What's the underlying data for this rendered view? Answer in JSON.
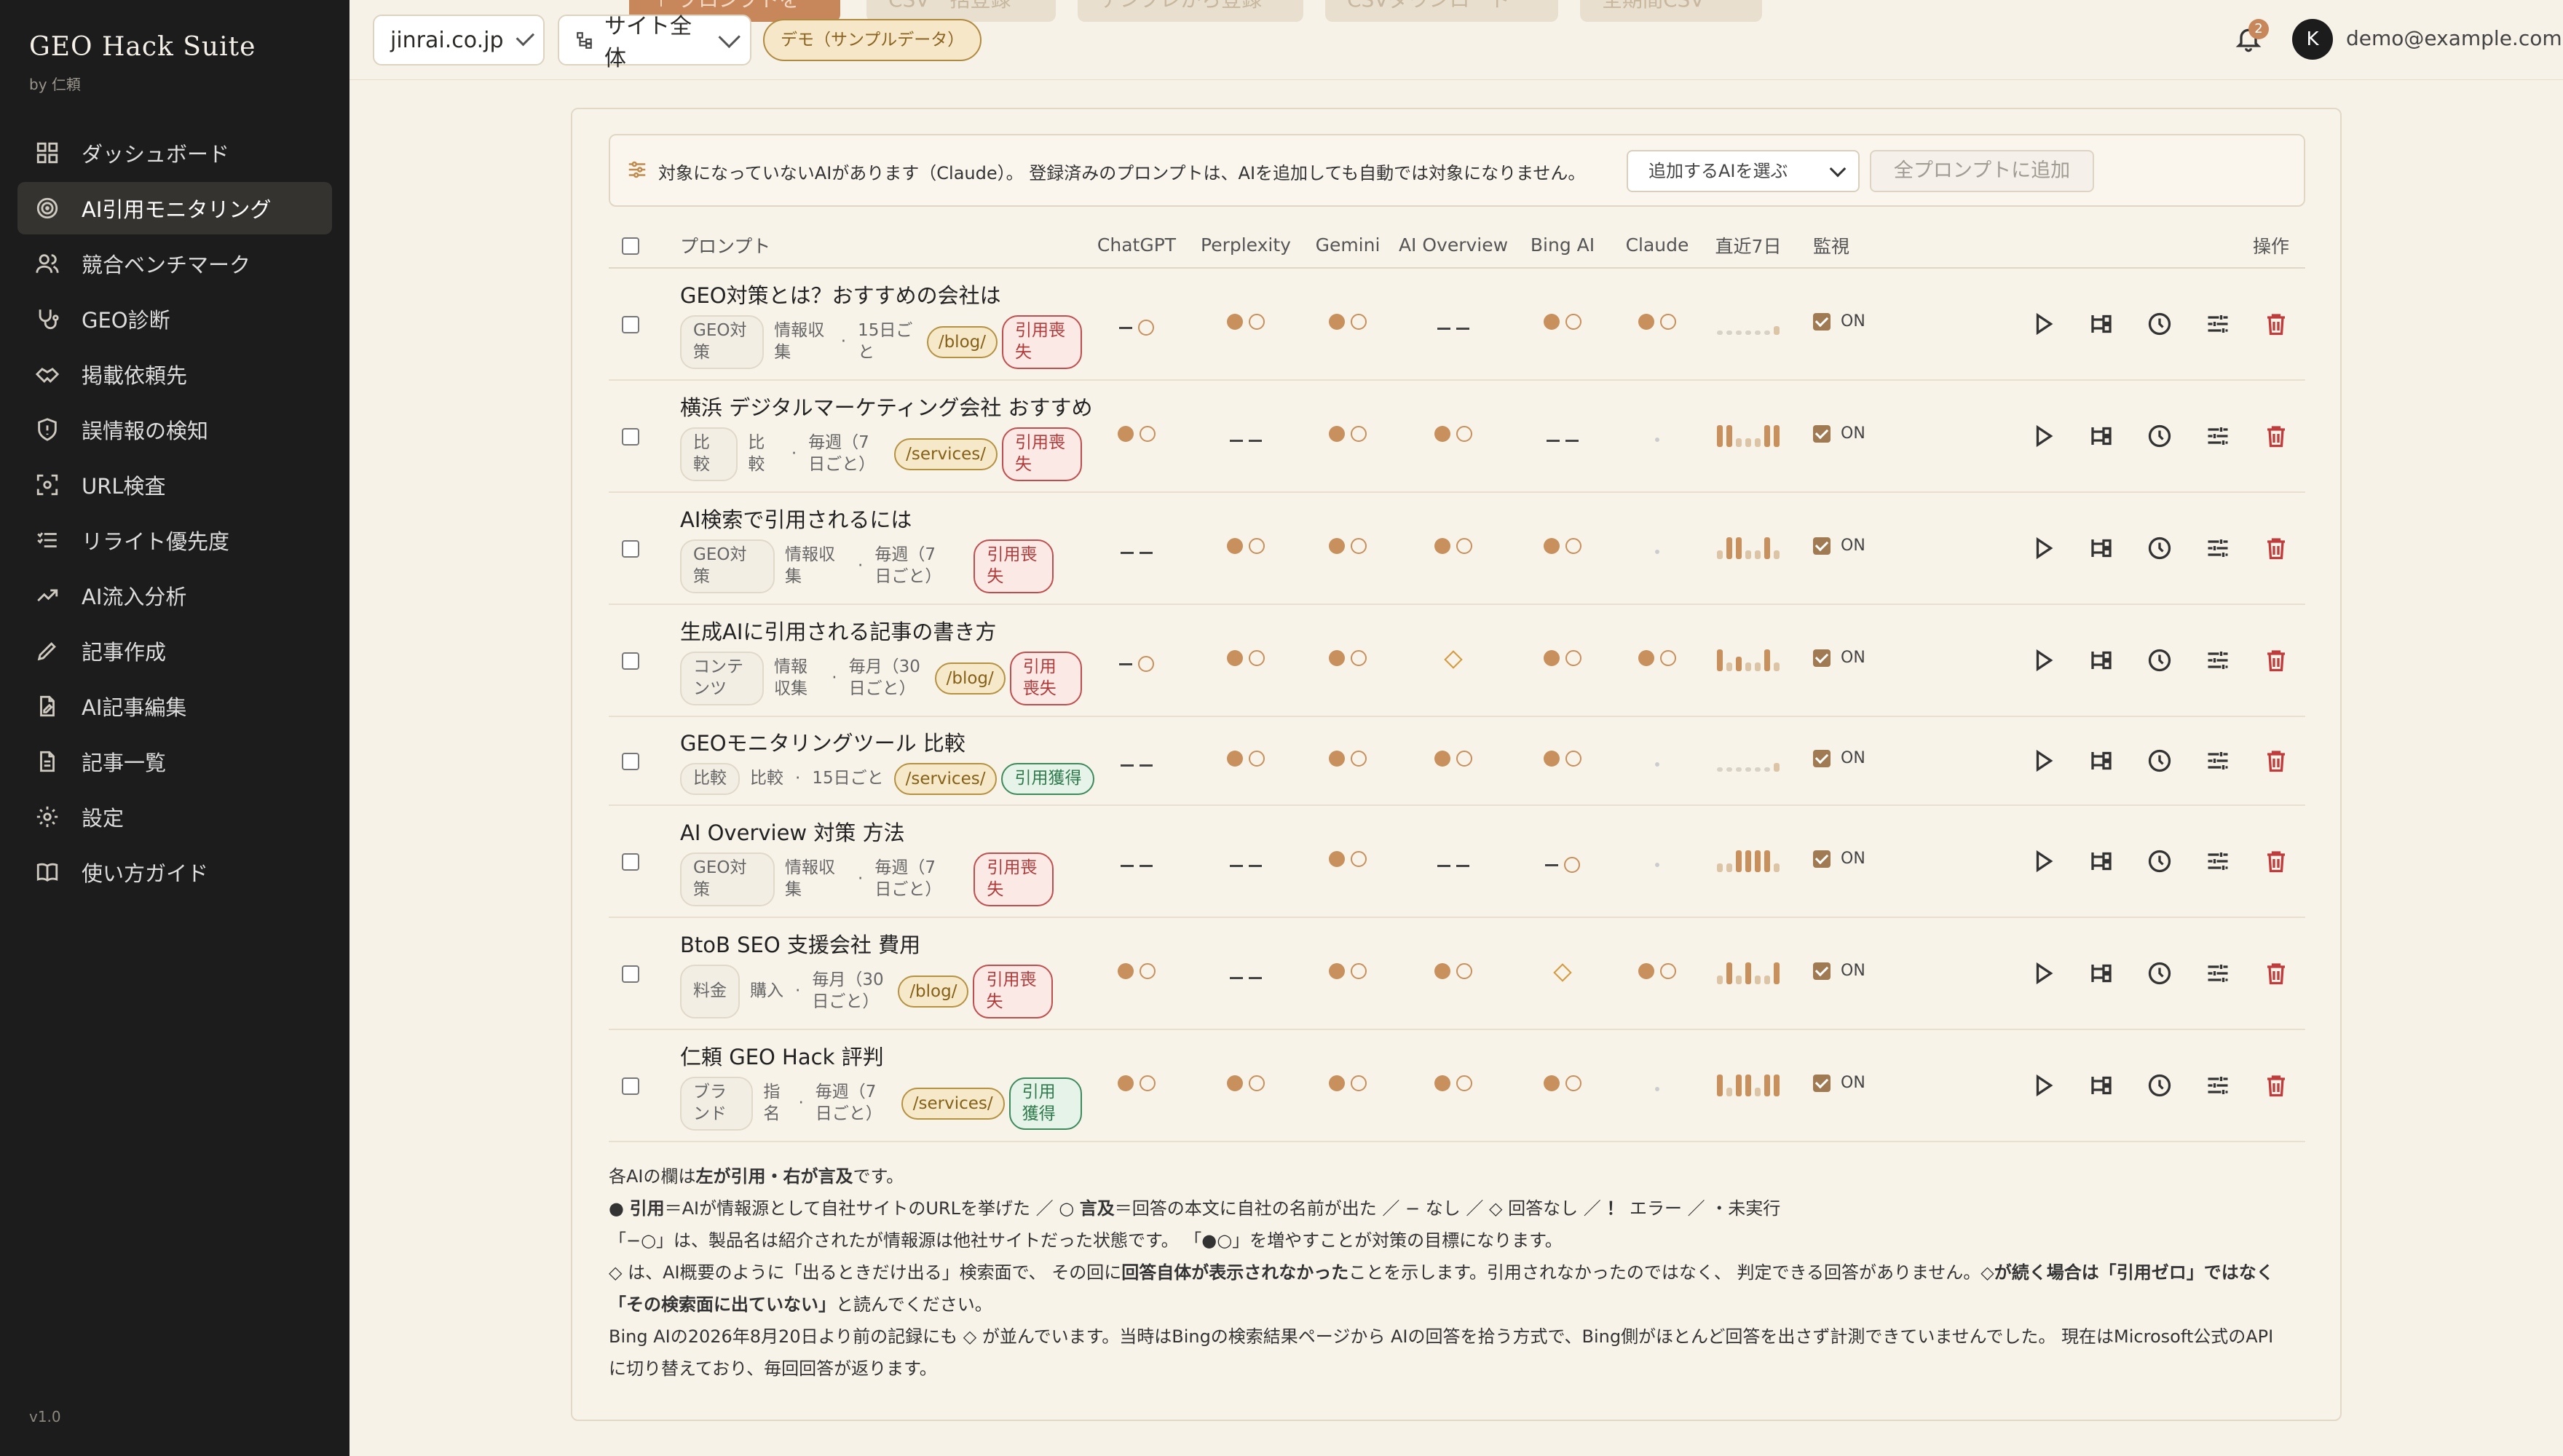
{
  "sidebar": {
    "brand": "GEO Hack Suite",
    "brand_sub": "by 仁頼",
    "items": [
      {
        "label": "ダッシュボード",
        "icon": "grid-icon"
      },
      {
        "label": "AI引用モニタリング",
        "icon": "target-icon",
        "active": true
      },
      {
        "label": "競合ベンチマーク",
        "icon": "users-icon"
      },
      {
        "label": "GEO診断",
        "icon": "stethoscope-icon"
      },
      {
        "label": "掲載依頼先",
        "icon": "handshake-icon"
      },
      {
        "label": "誤情報の検知",
        "icon": "shield-icon"
      },
      {
        "label": "URL検査",
        "icon": "scan-icon"
      },
      {
        "label": "リライト優先度",
        "icon": "list-icon"
      },
      {
        "label": "AI流入分析",
        "icon": "trend-icon"
      },
      {
        "label": "記事作成",
        "icon": "pen-icon"
      },
      {
        "label": "AI記事編集",
        "icon": "file-edit-icon"
      },
      {
        "label": "記事一覧",
        "icon": "file-list-icon"
      },
      {
        "label": "設定",
        "icon": "gear-icon"
      },
      {
        "label": "使い方ガイド",
        "icon": "book-icon"
      }
    ],
    "version": "v1.0"
  },
  "topbar": {
    "ghost_buttons": [
      "＋ プロンプトを追加",
      "CSV一括登録",
      "テンプレから登録",
      "CSVダウンロード",
      "全期間CSV"
    ],
    "domain_select": "jinrai.co.jp",
    "scope_select": "サイト全体",
    "demo_badge": "デモ（サンプルデータ）",
    "notification_count": "2",
    "avatar_initial": "K",
    "user_email": "demo@example.com"
  },
  "notice": {
    "text": "対象になっていないAIがあります（Claude）。 登録済みのプロンプトは、AIを追加しても自動では対象になりません。",
    "select_placeholder": "追加するAIを選ぶ",
    "add_all_button": "全プロンプトに追加"
  },
  "table": {
    "headers": {
      "prompt": "プロンプト",
      "engines": [
        "ChatGPT",
        "Perplexity",
        "Gemini",
        "AI Overview",
        "Bing AI",
        "Claude"
      ],
      "recent": "直近7日",
      "monitor": "監視",
      "actions": "操作"
    },
    "monitor_label": "ON",
    "rows": [
      {
        "title": "GEO対策とは？おすすめの会社は",
        "tag": "GEO対策",
        "intent": "情報収集",
        "frequency": "15日ごと",
        "path": "/blog/",
        "status": "引用喪失",
        "status_type": "lost",
        "marks": [
          "-o",
          "do",
          "do",
          "--",
          "do",
          "do"
        ],
        "spark": [
          0,
          0,
          0,
          0,
          0,
          0,
          1
        ]
      },
      {
        "title": "横浜 デジタルマーケティング会社 おすすめ",
        "tag": "比較",
        "intent": "比較",
        "frequency": "毎週（7日ごと）",
        "path": "/services/",
        "status": "引用喪失",
        "status_type": "lost",
        "marks": [
          "do",
          "--",
          "do",
          "do",
          "--",
          "."
        ],
        "spark": [
          3,
          3,
          1,
          1,
          1,
          3,
          3
        ]
      },
      {
        "title": "AI検索で引用されるには",
        "tag": "GEO対策",
        "intent": "情報収集",
        "frequency": "毎週（7日ごと）",
        "path": "",
        "status": "引用喪失",
        "status_type": "lost",
        "marks": [
          "--",
          "do",
          "do",
          "do",
          "do",
          "."
        ],
        "spark": [
          1,
          3,
          3,
          1,
          1,
          3,
          1
        ]
      },
      {
        "title": "生成AIに引用される記事の書き方",
        "tag": "コンテンツ",
        "intent": "情報収集",
        "frequency": "毎月（30日ごと）",
        "path": "/blog/",
        "status": "引用喪失",
        "status_type": "lost",
        "marks": [
          "-o",
          "do",
          "do",
          "◇",
          "do",
          "do"
        ],
        "spark": [
          3,
          1,
          2,
          1,
          1,
          3,
          1
        ]
      },
      {
        "title": "GEOモニタリングツール 比較",
        "tag": "比較",
        "intent": "比較",
        "frequency": "15日ごと",
        "path": "/services/",
        "status": "引用獲得",
        "status_type": "gain",
        "marks": [
          "--",
          "do",
          "do",
          "do",
          "do",
          "."
        ],
        "spark": [
          0,
          0,
          0,
          0,
          0,
          0,
          1
        ]
      },
      {
        "title": "AI Overview 対策 方法",
        "tag": "GEO対策",
        "intent": "情報収集",
        "frequency": "毎週（7日ごと）",
        "path": "",
        "status": "引用喪失",
        "status_type": "lost",
        "marks": [
          "--",
          "--",
          "do",
          "--",
          "-o",
          "."
        ],
        "spark": [
          1,
          1,
          3,
          3,
          3,
          3,
          1
        ]
      },
      {
        "title": "BtoB SEO 支援会社 費用",
        "tag": "料金",
        "intent": "購入",
        "frequency": "毎月（30日ごと）",
        "path": "/blog/",
        "status": "引用喪失",
        "status_type": "lost",
        "marks": [
          "do",
          "--",
          "do",
          "do",
          "◇",
          "do"
        ],
        "spark": [
          1,
          3,
          1,
          3,
          1,
          1,
          3
        ]
      },
      {
        "title": "仁頼 GEO Hack 評判",
        "tag": "ブランド",
        "intent": "指名",
        "frequency": "毎週（7日ごと）",
        "path": "/services/",
        "status": "引用獲得",
        "status_type": "gain",
        "marks": [
          "do",
          "do",
          "do",
          "do",
          "do",
          "."
        ],
        "spark": [
          3,
          1,
          3,
          3,
          1,
          3,
          3
        ]
      }
    ]
  },
  "legend": {
    "line1_a": "各AIの欄は",
    "line1_b": "左が引用・右が言及",
    "line1_c": "です。",
    "line2_a": "● ",
    "line2_b": "引用",
    "line2_c": "＝AIが情報源として自社サイトのURLを挙げた ／ ○ ",
    "line2_d": "言及",
    "line2_e": "＝回答の本文に自社の名前が出た ／ − なし ／ ◇ 回答なし ／ ",
    "line2_f": "！",
    "line2_g": " エラー ／ ・未実行",
    "line3": "「−○」は、製品名は紹介されたが情報源は他社サイトだった状態です。 「●○」を増やすことが対策の目標になります。",
    "line4_a": "◇ は、AI概要のように「出るときだけ出る」検索面で、 その回に",
    "line4_b": "回答自体が表示されなかった",
    "line4_c": "ことを示します。引用されなかったのではなく、 判定できる回答がありません。◇",
    "line4_d": "が続く場合は「引用ゼロ」ではなく",
    "line5_a": "「その検索面に出ていない」",
    "line5_b": "と読んでください。",
    "line6": "Bing AIの2026年8月20日より前の記録にも ◇ が並んでいます。当時はBingの検索結果ページから AIの回答を拾う方式で、Bing側がほとんど回答を出さず計測できていませんでした。 現在はMicrosoft公式のAPI",
    "line7": "に切り替えており、毎回回答が返ります。"
  },
  "colors": {
    "accent": "#c8905c",
    "sidebar_bg": "#1c1c1c",
    "page_bg": "#f7f2e8",
    "lost": "#b03a3a",
    "gain": "#2e7a4c"
  }
}
